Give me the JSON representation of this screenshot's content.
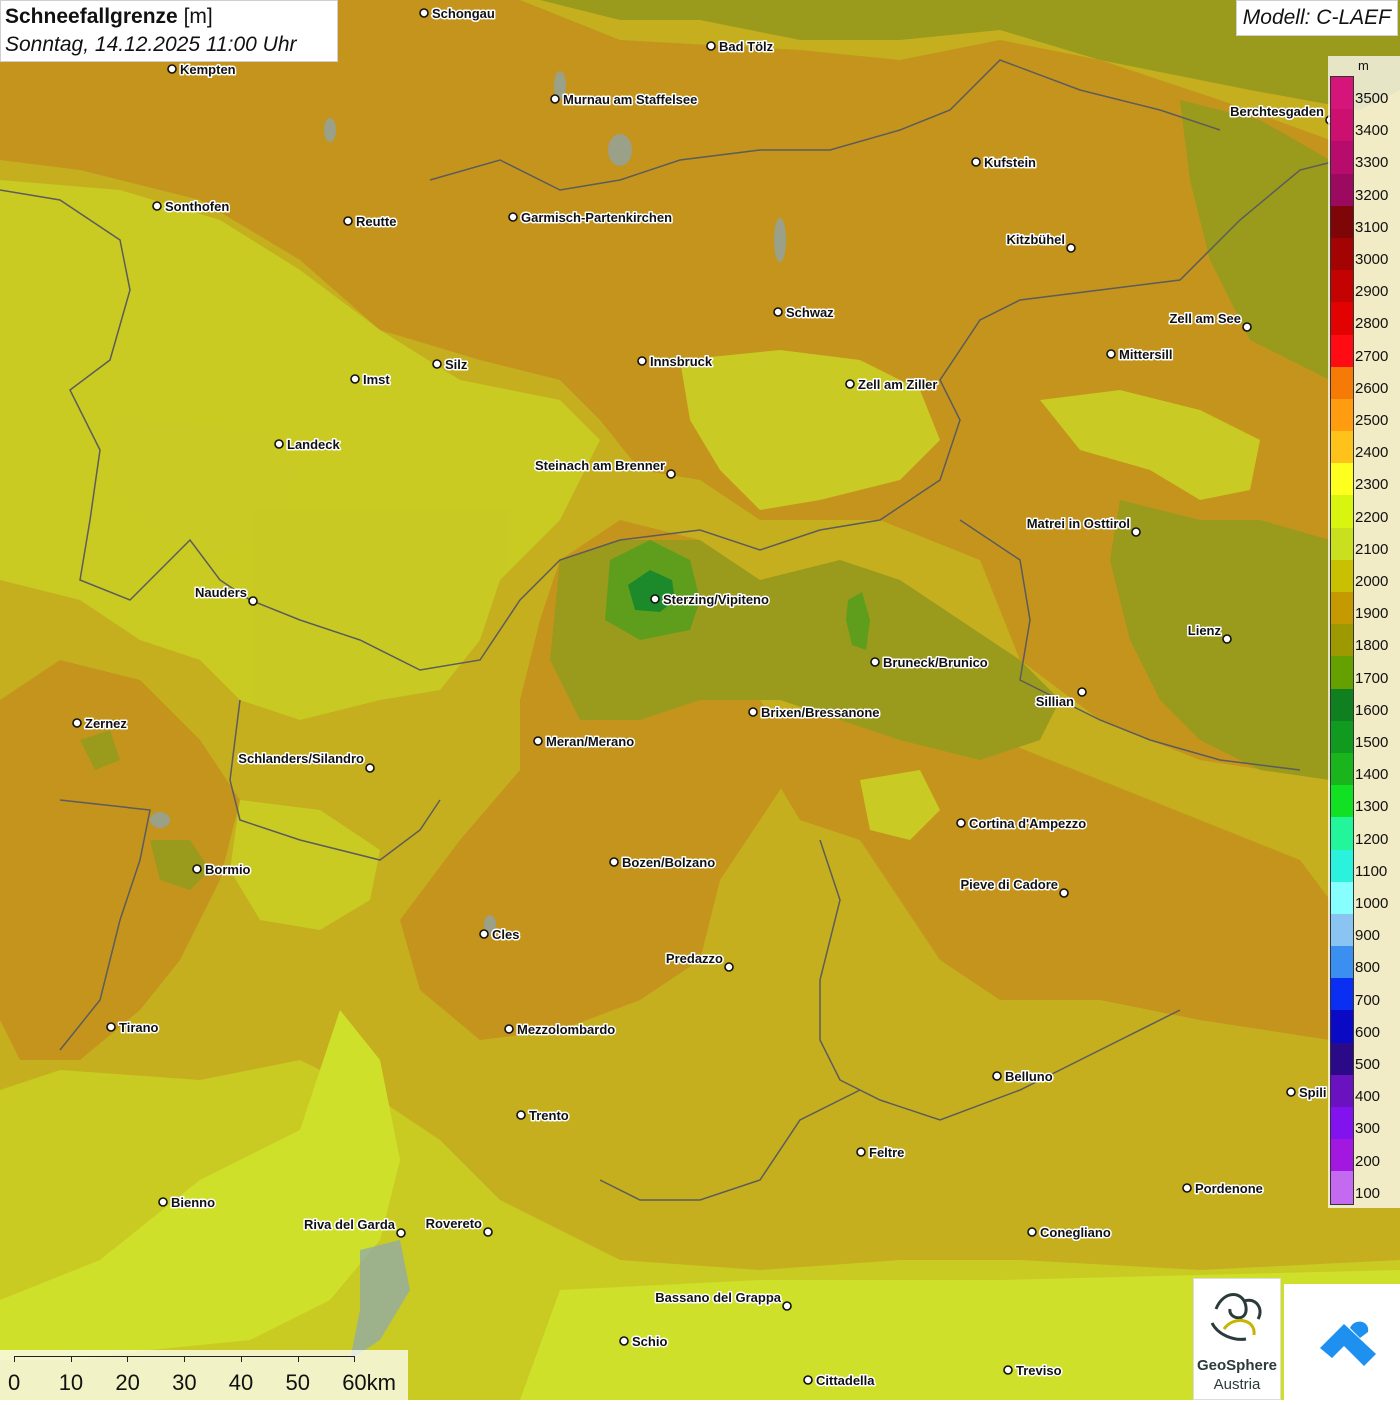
{
  "header": {
    "title": "Schneefallgrenze",
    "unit": "[m]",
    "datetime": "Sonntag, 14.12.2025 11:00 Uhr",
    "model": "Modell: C-LAEF"
  },
  "legend": {
    "unit": "m",
    "levels": [
      "3500",
      "3400",
      "3300",
      "3200",
      "3100",
      "3000",
      "2900",
      "2800",
      "2700",
      "2600",
      "2500",
      "2400",
      "2300",
      "2200",
      "2100",
      "2000",
      "1900",
      "1800",
      "1700",
      "1600",
      "1500",
      "1400",
      "1300",
      "1200",
      "1100",
      "1000",
      "900",
      "800",
      "700",
      "600",
      "500",
      "400",
      "300",
      "200",
      "100"
    ],
    "colors": [
      "#d6157a",
      "#cc1070",
      "#b80c6c",
      "#9b0a5f",
      "#7e0606",
      "#a30303",
      "#c30202",
      "#e20202",
      "#ff0b14",
      "#f57a06",
      "#ff9c10",
      "#ffc21a",
      "#ffff1f",
      "#d8f510",
      "#c8e01e",
      "#c8c000",
      "#c49a00",
      "#9c9a00",
      "#64a000",
      "#0f7f1f",
      "#109a1f",
      "#1ab51c",
      "#11e023",
      "#23f59b",
      "#2af2dc",
      "#88ffff",
      "#89c4f2",
      "#3b8ff0",
      "#0a2ff2",
      "#0a0ac4",
      "#2a0a86",
      "#6a12c0",
      "#8313ee",
      "#a218e0",
      "#c36af0"
    ]
  },
  "cities": [
    {
      "name": "Schongau"
    },
    {
      "name": "Bad Tölz"
    },
    {
      "name": "Kempten"
    },
    {
      "name": "Murnau am Staffelsee"
    },
    {
      "name": "Berchtesgaden"
    },
    {
      "name": "Kufstein"
    },
    {
      "name": "Sonthofen"
    },
    {
      "name": "Reutte"
    },
    {
      "name": "Garmisch-Partenkirchen"
    },
    {
      "name": "Kitzbühel"
    },
    {
      "name": "Schwaz"
    },
    {
      "name": "Zell am See"
    },
    {
      "name": "Innsbruck"
    },
    {
      "name": "Mittersill"
    },
    {
      "name": "Imst"
    },
    {
      "name": "Silz"
    },
    {
      "name": "Zell am Ziller"
    },
    {
      "name": "Landeck"
    },
    {
      "name": "Steinach am Brenner"
    },
    {
      "name": "Matrei in Osttirol"
    },
    {
      "name": "Nauders"
    },
    {
      "name": "Sterzing/Vipiteno"
    },
    {
      "name": "Lienz"
    },
    {
      "name": "Bruneck/Brunico"
    },
    {
      "name": "Sillian"
    },
    {
      "name": "Brixen/Bressanone"
    },
    {
      "name": "Zernez"
    },
    {
      "name": "Meran/Merano"
    },
    {
      "name": "Schlanders/Silandro"
    },
    {
      "name": "Cortina d'Ampezzo"
    },
    {
      "name": "Bozen/Bolzano"
    },
    {
      "name": "Bormio"
    },
    {
      "name": "Pieve di Cadore"
    },
    {
      "name": "Cles"
    },
    {
      "name": "Predazzo"
    },
    {
      "name": "Tirano"
    },
    {
      "name": "Mezzolombardo"
    },
    {
      "name": "Belluno"
    },
    {
      "name": "Spili"
    },
    {
      "name": "Trento"
    },
    {
      "name": "Feltre"
    },
    {
      "name": "Pordenone"
    },
    {
      "name": "Bienno"
    },
    {
      "name": "Riva del Garda"
    },
    {
      "name": "Rovereto"
    },
    {
      "name": "Conegliano"
    },
    {
      "name": "Bassano del Grappa"
    },
    {
      "name": "Schio"
    },
    {
      "name": "Treviso"
    },
    {
      "name": "Cittadella"
    }
  ],
  "scale": {
    "ticks": [
      "0",
      "10",
      "20",
      "30",
      "40",
      "50",
      "60km"
    ]
  },
  "logos": {
    "geosphere_line1": "GeoSphere",
    "geosphere_line2": "Austria"
  },
  "colors": {
    "base": "#c9b21e",
    "warm": "#c79a1a",
    "cool": "#c8d428",
    "green": "#8a9a1a",
    "core": "#1a8a2a",
    "app_blue": "#1e90f0"
  }
}
